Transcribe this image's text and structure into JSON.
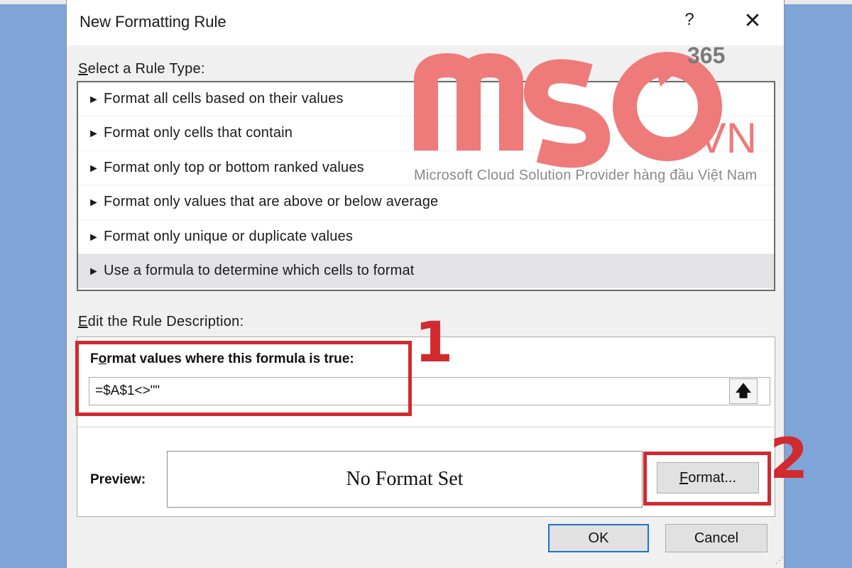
{
  "dialog": {
    "title": "New Formatting Rule",
    "help_label": "?",
    "close_label": "✕"
  },
  "rule_type": {
    "label_first": "S",
    "label_rest": "elect a Rule Type:",
    "arrow_glyph": "►",
    "items": [
      "Format all cells based on their values",
      "Format only cells that contain",
      "Format only top or bottom ranked values",
      "Format only values that are above or below average",
      "Format only unique or duplicate values",
      "Use a formula to determine which cells to format"
    ],
    "selected_index": 5
  },
  "description": {
    "label_first": "E",
    "label_rest": "dit the Rule Description:",
    "formula_label_pre": "F",
    "formula_label_u": "o",
    "formula_label_rest": "rmat values where this formula is true:",
    "formula_value": "=$A$1<>\"\"",
    "collapse_icon": "🡅",
    "preview_label": "Preview:",
    "preview_text": "No Format Set",
    "format_button_u": "F",
    "format_button_rest": "ormat..."
  },
  "footer": {
    "ok_label": "OK",
    "cancel_label": "Cancel"
  },
  "annotations": {
    "marker_1": "1",
    "marker_2": "2",
    "color": "#d12a2f"
  },
  "watermark": {
    "brand": "MSO",
    "suffix": ".VN",
    "superscript": "365",
    "tagline": "Microsoft Cloud Solution Provider hàng đầu Việt Nam",
    "color": "#ef7a7a"
  }
}
